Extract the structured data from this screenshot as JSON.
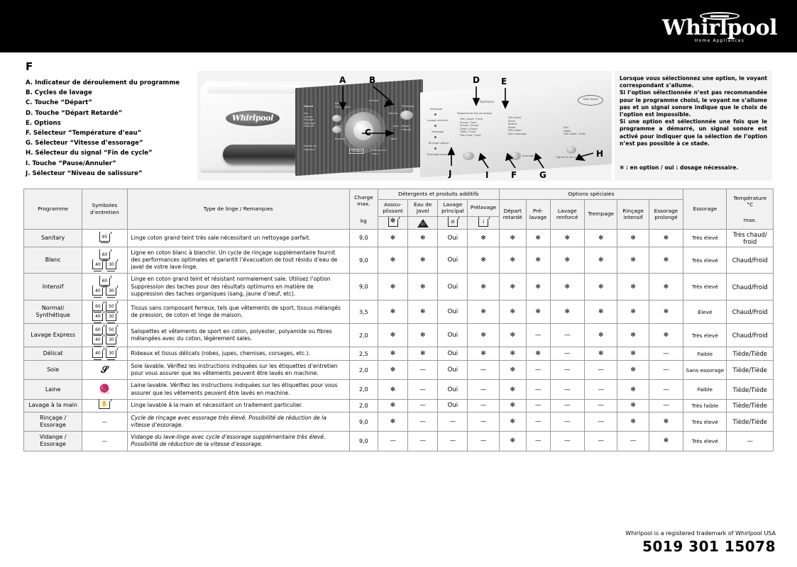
{
  "brand": {
    "name": "Whirlpool",
    "tagline": "Home Appliances"
  },
  "legend": {
    "section_letter": "F",
    "items": [
      "A. Indicateur de déroulement du programme",
      "B. Cycles de lavage",
      "C. Touche “Départ”",
      "D. Touche “Départ Retardé”",
      "E. Options",
      "F. Sélecteur “Température d’eau”",
      "G. Sélecteur “Vitesse d’essorage”",
      "H. Sélecteur du signal “Fin de cycle”",
      "I. Touche “Pause/Annuler”",
      "J. Sélecteur “Niveau de salissure”"
    ]
  },
  "photo": {
    "callouts": [
      "A",
      "B",
      "C",
      "D",
      "E",
      "F",
      "G",
      "H",
      "I",
      "J"
    ],
    "panel_labels": {
      "options_title": "Options",
      "start_button": "Départ",
      "delay_button": "Départ Retardé",
      "pause_button": "Pause",
      "sixth_sense": "Sixth Sense",
      "cycle_sanitary": "Sanitary",
      "cycle_normal": "Normal/ Synthétique",
      "cycle_blanc": "Blanc",
      "cycle_intensif": "Intensif",
      "cycle_delicat": "Délicat",
      "cycle_soie": "Soie",
      "cycle_laine": "Laine",
      "cycle_main": "Lavage à la main",
      "opt_prelavage": "Prélavage",
      "opt_lavage_renforce": "Lavage renforcé",
      "opt_trempage": "Trempage",
      "opt_rincage": "Rinçage intensif",
      "opt_essorage": "Essorage prolongé",
      "temp_title": "Température Eau de lavage",
      "spin_title": "Essorage",
      "signal_title": "Signal Fin de cycle"
    }
  },
  "note": {
    "paragraphs": [
      "Lorsque vous sélectionnez une option, le voyant correspondant s’allume.",
      "Si l’option sélectionnée n’est pas recommandée pour le programme choisi, le voyant ne s’allume pas et un signal sonore indique que le choix de l’option est impossible.",
      "Si une option est sélectionnée une fois que le programme a démarré, un signal sonore est activé pour indiquer que la sélection de l’option n’est pas possible à ce stade."
    ],
    "legend_line": "✻ : en option / oui : dosage nécessaire."
  },
  "table": {
    "headers": {
      "programme": "Programme",
      "symboles": "Symboles d’entretien",
      "type_linge": "Type de linge / Remarques",
      "charge_max": "Charge max.",
      "charge_unit": "kg",
      "group_detergents": "Détergents et produits additifs",
      "group_options": "Options spéciales",
      "essorage": "Essorage",
      "temperature": "Température",
      "temperature_unit": "°C",
      "temperature_max": "max.",
      "assouplissant": "Assou- plissant",
      "eau_de_javel": "Eau de Javel",
      "lavage_principal": "Lavage principal",
      "prelavage_det": "Prélavage",
      "depart_retarde": "Départ retardé",
      "pre_lavage": "Pré- lavage",
      "lavage_renforce": "Lavage renforcé",
      "trempage": "Trempage",
      "rincage_intensif": "Rinçage intensif",
      "essorage_prolonge": "Essorage prolongé",
      "sym_softener": "softener-symbol",
      "sym_bleach": "bleach-triangle-symbol",
      "sym_mainwash": "main-wash-tub-symbol",
      "sym_prewash": "prewash-tub-symbol",
      "sym_mainwash_text": "III",
      "sym_prewash_text": "I"
    },
    "rows": [
      {
        "programme": "Sanitary",
        "care_symbols": [
          [
            "95"
          ]
        ],
        "care_style": "single",
        "description": "Linge coton grand teint très sale nécessitant un nettoyage parfait.",
        "italic": false,
        "charge": "9,0",
        "cells": [
          "✻",
          "✻",
          "Oui",
          "✻",
          "✻",
          "✻",
          "✻",
          "✻",
          "✻",
          "✻"
        ],
        "essorage": "Très élevé",
        "temperature": "Très chaud/ froid"
      },
      {
        "programme": "Blanc",
        "care_symbols": [
          [
            "60"
          ],
          [
            "40",
            "30"
          ]
        ],
        "care_style": "pyramid",
        "description": "Ligne en coton blanc à blanchir. Un cycle de rinçage supplémentaire fournit des performances optimales et garantit l’évacuation de tout résidu d’eau de javel de votre lave-linge.",
        "italic": false,
        "charge": "9,0",
        "cells": [
          "✻",
          "✻",
          "Oui",
          "✻",
          "✻",
          "✻",
          "✻",
          "✻",
          "✻",
          "✻"
        ],
        "essorage": "Très élevé",
        "temperature": "Chaud/Froid"
      },
      {
        "programme": "Intensif",
        "care_symbols": [
          [
            "60"
          ],
          [
            "40",
            "30"
          ]
        ],
        "care_style": "pyramid",
        "description": "Linge en coton grand teint et résistant normalement sale. Utilisez l’option Suppression des taches pour des résultats optimums en matière de suppression des taches organiques (sang, jaune d’oeuf, etc).",
        "italic": false,
        "charge": "9,0",
        "cells": [
          "✻",
          "✻",
          "Oui",
          "✻",
          "✻",
          "✻",
          "✻",
          "✻",
          "✻",
          "✻"
        ],
        "essorage": "Très élevé",
        "temperature": "Chaud/Froid"
      },
      {
        "programme": "Normal/ Synthétique",
        "care_symbols": [
          [
            "60",
            "50"
          ],
          [
            "40",
            "30"
          ]
        ],
        "care_style": "grid",
        "description": "Tissus sans composant ferreux, tels que vêtements de sport, tissus mélangés de pression, de coton et linge de maison.",
        "italic": false,
        "charge": "3,5",
        "cells": [
          "✻",
          "✻",
          "Oui",
          "✻",
          "✻",
          "✻",
          "✻",
          "✻",
          "✻",
          "✻"
        ],
        "essorage": "Élevé",
        "temperature": "Chaud/Froid"
      },
      {
        "programme": "Lavage Express",
        "care_symbols": [
          [
            "60",
            "50"
          ],
          [
            "40",
            "30"
          ]
        ],
        "care_style": "grid",
        "description": "Salopettes et vêtements de sport en coton, polyester, polyamide ou fibres mélangées avec du coton, légèrement sales.",
        "italic": false,
        "charge": "2,0",
        "cells": [
          "✻",
          "✻",
          "Oui",
          "✻",
          "✻",
          "—",
          "—",
          "✻",
          "✻",
          "✻"
        ],
        "essorage": "Très élevé",
        "temperature": "Chaud/Froid"
      },
      {
        "programme": "Délicat",
        "care_symbols": [
          [
            "40",
            "30"
          ]
        ],
        "care_style": "row",
        "description": "Rideaux et tissus délicats (robes, jupes, chemises, corsages, etc.).",
        "italic": false,
        "charge": "2,5",
        "cells": [
          "✻",
          "✻",
          "Oui",
          "✻",
          "✻",
          "✻",
          "—",
          "✻",
          "✻",
          "—"
        ],
        "essorage": "Faible",
        "temperature": "Tiède/Tiède"
      },
      {
        "programme": "Soie",
        "care_symbols": [],
        "care_style": "silk",
        "description": "Soie lavable. Vérifiez les instructions indiquées sur les étiquettes d’entretien pour vous assurer que les vêtements peuvent être lavés en machine.",
        "italic": false,
        "charge": "2,0",
        "cells": [
          "✻",
          "—",
          "Oui",
          "—",
          "✻",
          "—",
          "—",
          "—",
          "✻",
          "—"
        ],
        "essorage": "Sans essorage",
        "temperature": "Tiède/Tiède"
      },
      {
        "programme": "Laine",
        "care_symbols": [],
        "care_style": "wool",
        "description": "Laine lavable. Vérifiez les instructions indiquées sur les étiquettes pour vous assurer que les vêtements peuvent être lavés en machine.",
        "italic": false,
        "charge": "2,0",
        "cells": [
          "✻",
          "—",
          "Oui",
          "—",
          "✻",
          "—",
          "—",
          "—",
          "✻",
          "—"
        ],
        "essorage": "Faible",
        "temperature": "Tiède/Tiède"
      },
      {
        "programme": "Lavage à la main",
        "care_symbols": [],
        "care_style": "hand",
        "description": "Linge lavable à la main et nécessitant un traitement particulier.",
        "italic": false,
        "charge": "2,0",
        "cells": [
          "✻",
          "—",
          "Oui",
          "—",
          "✻",
          "—",
          "—",
          "—",
          "✻",
          "—"
        ],
        "essorage": "Très faible",
        "temperature": "Tiède/Tiède"
      },
      {
        "programme": "Rinçage / Essorage",
        "care_symbols": [],
        "care_style": "dash",
        "care_dash": "—",
        "description": "Cycle de rinçage avec essorage très élevé. Possibilité de réduction de la vitesse d’essorage.",
        "italic": true,
        "charge": "9,0",
        "cells": [
          "✻",
          "—",
          "—",
          "—",
          "✻",
          "—",
          "—",
          "—",
          "✻",
          "✻"
        ],
        "essorage": "Très élevé",
        "temperature": "Tiède/Tiède"
      },
      {
        "programme": "Vidange / Essorage",
        "care_symbols": [],
        "care_style": "dash",
        "care_dash": "—",
        "description": "Vidange du lave-linge avec cycle d’essorage supplémentaire très élevé. Possibilité de réduction de la vitesse d’essorage.",
        "italic": true,
        "charge": "9,0",
        "cells": [
          "—",
          "—",
          "—",
          "—",
          "✻",
          "—",
          "—",
          "—",
          "—",
          "✻"
        ],
        "essorage": "Très élevé",
        "temperature": "—"
      }
    ]
  },
  "footer": {
    "trademark": "Whirlpool is a registered trademark of Whirlpool USA",
    "code": "5019 301 15078"
  }
}
